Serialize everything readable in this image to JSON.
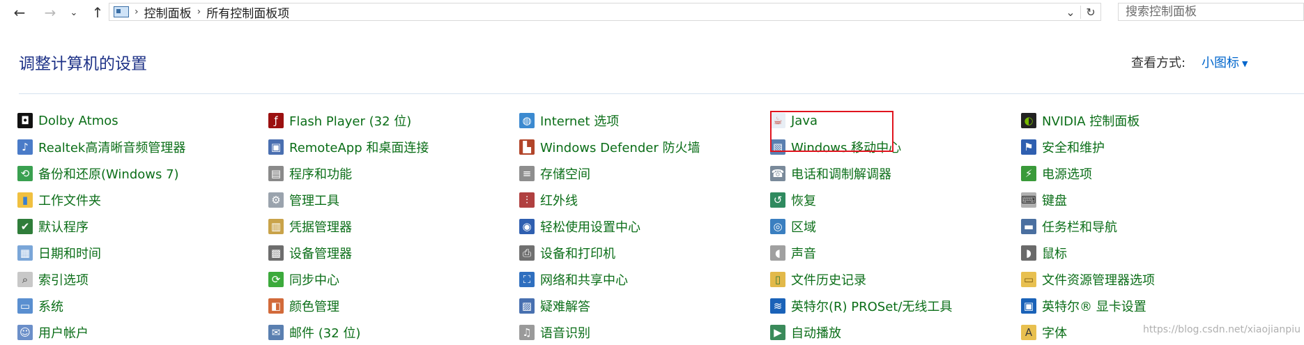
{
  "address_bar": {
    "crumbs": [
      "控制面板",
      "所有控制面板项"
    ],
    "search_placeholder": "搜索控制面板"
  },
  "header": {
    "title": "调整计算机的设置",
    "view_by_label": "查看方式:",
    "view_by_value": "小图标"
  },
  "columns": [
    {
      "items": [
        {
          "label": "Dolby Atmos",
          "icon": "dolby-icon",
          "icon_glyph": "◘",
          "icon_bg": "#111111",
          "icon_fg": "#ffffff"
        },
        {
          "label": "Realtek高清晰音频管理器",
          "icon": "realtek-speaker-icon",
          "icon_glyph": "♪",
          "icon_bg": "#4a7bc8",
          "icon_fg": "#ffffff"
        },
        {
          "label": "备份和还原(Windows 7)",
          "icon": "backup-icon",
          "icon_glyph": "⟲",
          "icon_bg": "#3aa050",
          "icon_fg": "#ffffff"
        },
        {
          "label": "工作文件夹",
          "icon": "work-folders-icon",
          "icon_glyph": "▮",
          "icon_bg": "#f0c040",
          "icon_fg": "#3a7fd0"
        },
        {
          "label": "默认程序",
          "icon": "default-programs-icon",
          "icon_glyph": "✔",
          "icon_bg": "#2f7d3a",
          "icon_fg": "#ffffff"
        },
        {
          "label": "日期和时间",
          "icon": "date-time-icon",
          "icon_glyph": "▦",
          "icon_bg": "#7aa6d8",
          "icon_fg": "#ffffff"
        },
        {
          "label": "索引选项",
          "icon": "indexing-icon",
          "icon_glyph": "⌕",
          "icon_bg": "#c8c8c8",
          "icon_fg": "#333333"
        },
        {
          "label": "系统",
          "icon": "system-icon",
          "icon_glyph": "▭",
          "icon_bg": "#5a8fd0",
          "icon_fg": "#ffffff"
        },
        {
          "label": "用户帐户",
          "icon": "user-accounts-icon",
          "icon_glyph": "☺",
          "icon_bg": "#6b8fc9",
          "icon_fg": "#ffffff"
        }
      ]
    },
    {
      "items": [
        {
          "label": "Flash Player (32 位)",
          "icon": "flash-icon",
          "icon_glyph": "ƒ",
          "icon_bg": "#9b1010",
          "icon_fg": "#ffffff"
        },
        {
          "label": "RemoteApp 和桌面连接",
          "icon": "remoteapp-icon",
          "icon_glyph": "▣",
          "icon_bg": "#4a6fb0",
          "icon_fg": "#ffffff"
        },
        {
          "label": "程序和功能",
          "icon": "programs-icon",
          "icon_glyph": "▤",
          "icon_bg": "#8a8a8a",
          "icon_fg": "#ffffff"
        },
        {
          "label": "管理工具",
          "icon": "admin-tools-icon",
          "icon_glyph": "⚙",
          "icon_bg": "#9aa3ad",
          "icon_fg": "#ffffff"
        },
        {
          "label": "凭据管理器",
          "icon": "credential-manager-icon",
          "icon_glyph": "▥",
          "icon_bg": "#c9a34a",
          "icon_fg": "#ffffff"
        },
        {
          "label": "设备管理器",
          "icon": "device-manager-icon",
          "icon_glyph": "▩",
          "icon_bg": "#6d6d6d",
          "icon_fg": "#ffffff"
        },
        {
          "label": "同步中心",
          "icon": "sync-center-icon",
          "icon_glyph": "⟳",
          "icon_bg": "#3caa3c",
          "icon_fg": "#ffffff"
        },
        {
          "label": "颜色管理",
          "icon": "color-management-icon",
          "icon_glyph": "◧",
          "icon_bg": "#d26a3a",
          "icon_fg": "#ffffff"
        },
        {
          "label": "邮件 (32 位)",
          "icon": "mail-icon",
          "icon_glyph": "✉",
          "icon_bg": "#5a7fb0",
          "icon_fg": "#ffffff"
        }
      ]
    },
    {
      "items": [
        {
          "label": "Internet 选项",
          "icon": "internet-options-icon",
          "icon_glyph": "◍",
          "icon_bg": "#3c8ad0",
          "icon_fg": "#ffffff"
        },
        {
          "label": "Windows Defender 防火墙",
          "icon": "firewall-icon",
          "icon_glyph": "▙",
          "icon_bg": "#b2452a",
          "icon_fg": "#ffffff"
        },
        {
          "label": "存储空间",
          "icon": "storage-spaces-icon",
          "icon_glyph": "≡",
          "icon_bg": "#8e8e8e",
          "icon_fg": "#ffffff"
        },
        {
          "label": "红外线",
          "icon": "infrared-icon",
          "icon_glyph": "⫶",
          "icon_bg": "#b04040",
          "icon_fg": "#ffffff"
        },
        {
          "label": "轻松使用设置中心",
          "icon": "ease-of-access-icon",
          "icon_glyph": "◉",
          "icon_bg": "#2f5fb0",
          "icon_fg": "#ffffff"
        },
        {
          "label": "设备和打印机",
          "icon": "devices-printers-icon",
          "icon_glyph": "⎙",
          "icon_bg": "#707070",
          "icon_fg": "#ffffff"
        },
        {
          "label": "网络和共享中心",
          "icon": "network-center-icon",
          "icon_glyph": "⛶",
          "icon_bg": "#2f6fbf",
          "icon_fg": "#ffffff"
        },
        {
          "label": "疑难解答",
          "icon": "troubleshooting-icon",
          "icon_glyph": "▨",
          "icon_bg": "#4870b0",
          "icon_fg": "#ffffff"
        },
        {
          "label": "语音识别",
          "icon": "speech-recognition-icon",
          "icon_glyph": "♫",
          "icon_bg": "#9a9a9a",
          "icon_fg": "#ffffff"
        }
      ]
    },
    {
      "items": [
        {
          "label": "Java",
          "icon": "java-icon",
          "icon_glyph": "☕",
          "icon_bg": "#e8eef5",
          "icon_fg": "#c0392b"
        },
        {
          "label": "Windows 移动中心",
          "icon": "mobility-center-icon",
          "icon_glyph": "▧",
          "icon_bg": "#5a7fb0",
          "icon_fg": "#ffffff"
        },
        {
          "label": "电话和调制解调器",
          "icon": "phone-modem-icon",
          "icon_glyph": "☎",
          "icon_bg": "#7a8a9a",
          "icon_fg": "#ffffff"
        },
        {
          "label": "恢复",
          "icon": "recovery-icon",
          "icon_glyph": "↺",
          "icon_bg": "#2f8a5f",
          "icon_fg": "#ffffff"
        },
        {
          "label": "区域",
          "icon": "region-icon",
          "icon_glyph": "◎",
          "icon_bg": "#3a7fc0",
          "icon_fg": "#ffffff"
        },
        {
          "label": "声音",
          "icon": "sound-icon",
          "icon_glyph": "◖",
          "icon_bg": "#a0a0a0",
          "icon_fg": "#ffffff"
        },
        {
          "label": "文件历史记录",
          "icon": "file-history-icon",
          "icon_glyph": "▯",
          "icon_bg": "#e2b94a",
          "icon_fg": "#3a7a3a"
        },
        {
          "label": "英特尔(R) PROSet/无线工具",
          "icon": "intel-proset-icon",
          "icon_glyph": "≋",
          "icon_bg": "#1a62b8",
          "icon_fg": "#ffffff"
        },
        {
          "label": "自动播放",
          "icon": "autoplay-icon",
          "icon_glyph": "▶",
          "icon_bg": "#3a8a5a",
          "icon_fg": "#ffffff"
        }
      ]
    },
    {
      "items": [
        {
          "label": "NVIDIA 控制面板",
          "icon": "nvidia-icon",
          "icon_glyph": "◐",
          "icon_bg": "#222222",
          "icon_fg": "#76b900"
        },
        {
          "label": "安全和维护",
          "icon": "security-maintenance-icon",
          "icon_glyph": "⚑",
          "icon_bg": "#2f5fb0",
          "icon_fg": "#ffffff"
        },
        {
          "label": "电源选项",
          "icon": "power-options-icon",
          "icon_glyph": "⚡",
          "icon_bg": "#3a9a3a",
          "icon_fg": "#ffffff"
        },
        {
          "label": "键盘",
          "icon": "keyboard-icon",
          "icon_glyph": "⌨",
          "icon_bg": "#b0b0b0",
          "icon_fg": "#333333"
        },
        {
          "label": "任务栏和导航",
          "icon": "taskbar-icon",
          "icon_glyph": "▬",
          "icon_bg": "#4a6fa0",
          "icon_fg": "#ffffff"
        },
        {
          "label": "鼠标",
          "icon": "mouse-icon",
          "icon_glyph": "◗",
          "icon_bg": "#6a6a6a",
          "icon_fg": "#ffffff"
        },
        {
          "label": "文件资源管理器选项",
          "icon": "file-explorer-options-icon",
          "icon_glyph": "▭",
          "icon_bg": "#e8c050",
          "icon_fg": "#7a5a10"
        },
        {
          "label": "英特尔® 显卡设置",
          "icon": "intel-graphics-icon",
          "icon_glyph": "▣",
          "icon_bg": "#1a62b8",
          "icon_fg": "#ffffff"
        },
        {
          "label": "字体",
          "icon": "fonts-icon",
          "icon_glyph": "A",
          "icon_bg": "#e8c050",
          "icon_fg": "#3a3a3a"
        }
      ]
    }
  ],
  "watermark": "https://blog.csdn.net/xiaojianpiu"
}
